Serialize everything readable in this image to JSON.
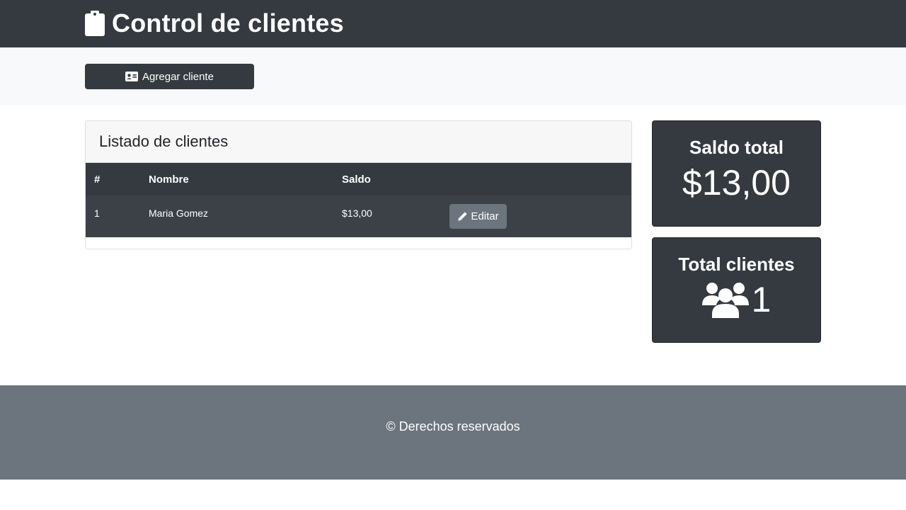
{
  "header": {
    "title": "Control de clientes",
    "icon": "clipboard-icon"
  },
  "actions": {
    "add_client_label": "Agregar cliente",
    "add_client_icon": "id-card-icon"
  },
  "client_list": {
    "title": "Listado de clientes",
    "columns": [
      "#",
      "Nombre",
      "Saldo",
      ""
    ],
    "rows": [
      {
        "num": "1",
        "name": "Maria Gomez",
        "saldo": "$13,00",
        "edit_label": "Editar"
      }
    ]
  },
  "stats": {
    "saldo_title": "Saldo total",
    "saldo_value": "$13,00",
    "clients_title": "Total clientes",
    "clients_count": "1",
    "clients_icon": "users-icon"
  },
  "footer": {
    "text": "© Derechos reservados"
  },
  "colors": {
    "dark": "#343a40",
    "light": "#f8f9fa",
    "secondary": "#6c757d",
    "white": "#ffffff"
  }
}
